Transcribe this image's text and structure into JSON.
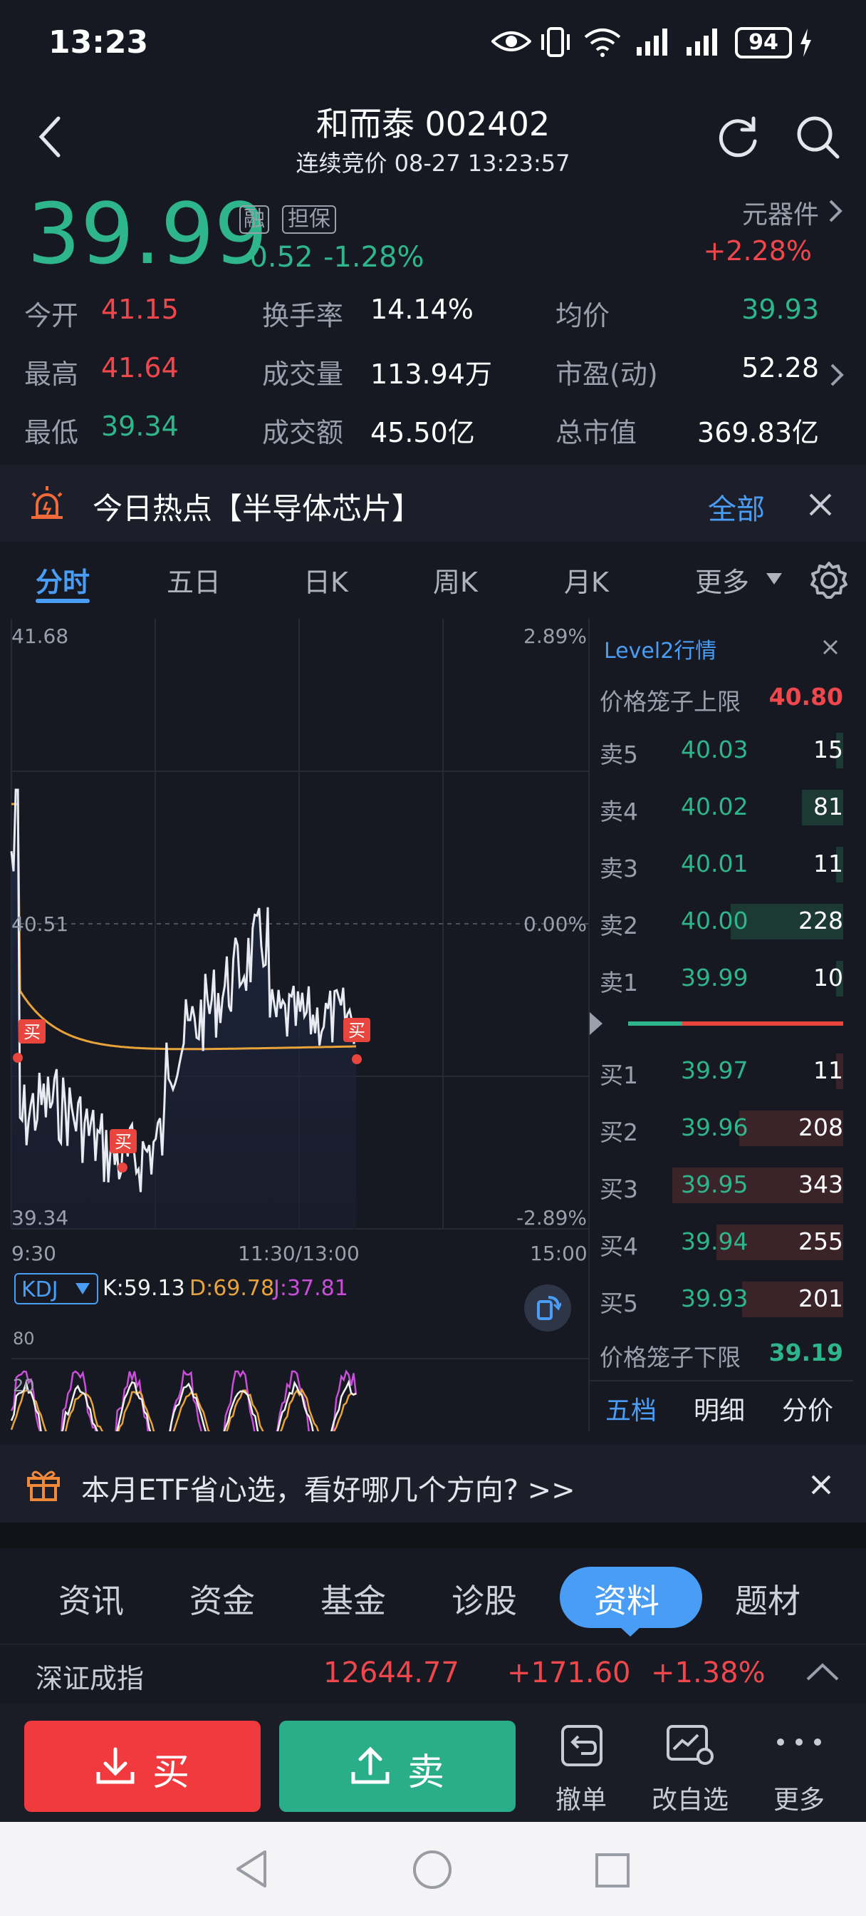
{
  "status_bar": {
    "time": "13:23",
    "battery": "94"
  },
  "header": {
    "title": "和而泰 002402",
    "subtitle": "连续竞价 08-27 13:23:57"
  },
  "quote": {
    "price": "39.99",
    "badge_rong": "融",
    "badge_danbao": "担保",
    "change": "-0.52",
    "change_pct": "-1.28%",
    "sector_name": "元器件",
    "sector_change": "+2.28%",
    "stats": [
      {
        "label": "今开",
        "value": "41.15"
      },
      {
        "label": "换手率",
        "value": "14.14%"
      },
      {
        "label": "均价",
        "value": "39.93"
      },
      {
        "label": "最高",
        "value": "41.64"
      },
      {
        "label": "成交量",
        "value": "113.94万"
      },
      {
        "label": "市盈(动)",
        "value": "52.28"
      },
      {
        "label": "最低",
        "value": "39.34"
      },
      {
        "label": "成交额",
        "value": "45.50亿"
      },
      {
        "label": "总市值",
        "value": "369.83亿"
      }
    ]
  },
  "hot": {
    "text": "今日热点【半导体芯片】",
    "all": "全部"
  },
  "chart_tabs": [
    "分时",
    "五日",
    "日K",
    "周K",
    "月K",
    "更多"
  ],
  "chart_labels": {
    "y_top": "41.68",
    "y_mid": "40.51",
    "y_bot": "39.34",
    "pct_top": "2.89%",
    "pct_mid": "0.00%",
    "pct_bot": "-2.89%",
    "t_start": "9:30",
    "t_mid": "11:30/13:00",
    "t_end": "15:00",
    "buy_mark": "买"
  },
  "kdj": {
    "name": "KDJ",
    "k": "K:59.13",
    "d": "D:69.78",
    "j": "J:37.81",
    "level_80": "80",
    "level_20": "20"
  },
  "orderbook": {
    "title": "Level2行情",
    "upper_label": "价格笼子上限",
    "upper_value": "40.80",
    "lower_label": "价格笼子下限",
    "lower_value": "39.19",
    "asks": [
      {
        "label": "卖5",
        "price": "40.03",
        "vol": "15",
        "bar": 0.04
      },
      {
        "label": "卖4",
        "price": "40.02",
        "vol": "81",
        "bar": 0.24
      },
      {
        "label": "卖3",
        "price": "40.01",
        "vol": "11",
        "bar": 0.03
      },
      {
        "label": "卖2",
        "price": "40.00",
        "vol": "228",
        "bar": 0.66
      },
      {
        "label": "卖1",
        "price": "39.99",
        "vol": "10",
        "bar": 0.03
      }
    ],
    "bids": [
      {
        "label": "买1",
        "price": "39.97",
        "vol": "11",
        "bar": 0.03
      },
      {
        "label": "买2",
        "price": "39.96",
        "vol": "208",
        "bar": 0.61
      },
      {
        "label": "买3",
        "price": "39.95",
        "vol": "343",
        "bar": 1.0
      },
      {
        "label": "买4",
        "price": "39.94",
        "vol": "255",
        "bar": 0.74
      },
      {
        "label": "买5",
        "price": "39.93",
        "vol": "201",
        "bar": 0.59
      }
    ],
    "tabs": [
      "五档",
      "明细",
      "分价"
    ]
  },
  "ad": {
    "text": "本月ETF省心选，看好哪几个方向? >>"
  },
  "info_tabs": [
    "资讯",
    "资金",
    "基金",
    "诊股",
    "资料",
    "题材"
  ],
  "index": {
    "name": "深证成指",
    "value": "12644.77",
    "change": "+171.60",
    "pct": "+1.38%"
  },
  "bottom": {
    "buy": "买",
    "sell": "卖",
    "cancel": "撤单",
    "watch": "改自选",
    "more": "更多"
  },
  "colors": {
    "up": "#f0474d",
    "down": "#2fb58b",
    "accent": "#4a9df5",
    "bg": "#161922"
  }
}
